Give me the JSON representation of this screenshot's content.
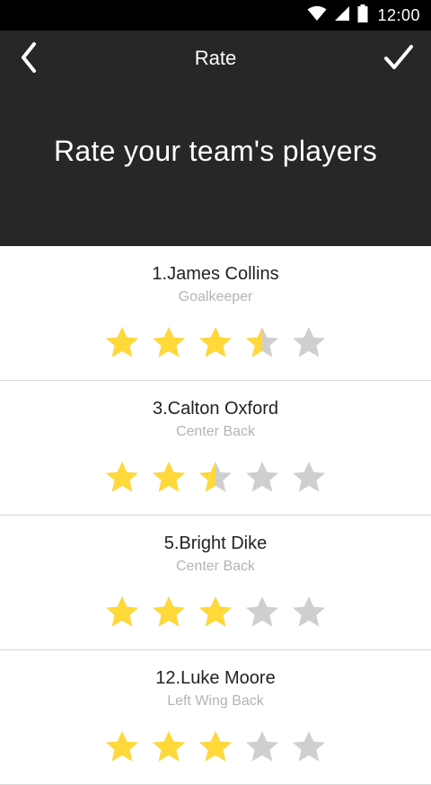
{
  "status_bar": {
    "time": "12:00",
    "icons": [
      "wifi-icon",
      "cell-signal-icon",
      "battery-icon"
    ]
  },
  "header": {
    "title": "Rate",
    "heading": "Rate your team's players",
    "back_icon": "chevron-left-icon",
    "confirm_icon": "checkmark-icon"
  },
  "colors": {
    "header_bg": "#262729",
    "status_bg": "#000000",
    "star_filled": "#FFD83A",
    "star_empty": "#CFCFCF"
  },
  "players": [
    {
      "name": "1.James Collins",
      "position": "Goalkeeper",
      "rating": 3.5,
      "max": 5
    },
    {
      "name": "3.Calton Oxford",
      "position": "Center Back",
      "rating": 2.5,
      "max": 5
    },
    {
      "name": "5.Bright Dike",
      "position": "Center Back",
      "rating": 3,
      "max": 5
    },
    {
      "name": "12.Luke Moore",
      "position": "Left Wing Back",
      "rating": 3,
      "max": 5
    }
  ]
}
